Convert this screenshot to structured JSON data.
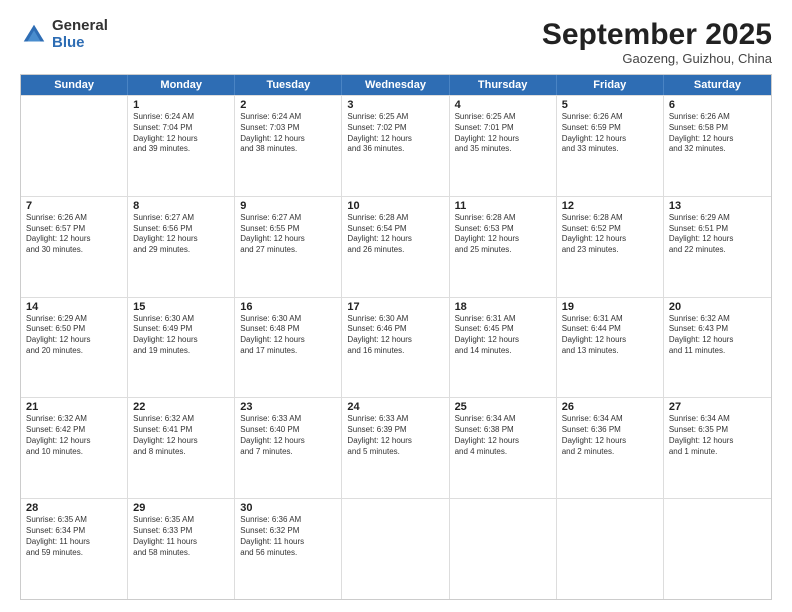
{
  "header": {
    "logo": {
      "general": "General",
      "blue": "Blue"
    },
    "title": "September 2025",
    "location": "Gaozeng, Guizhou, China"
  },
  "calendar": {
    "days": [
      "Sunday",
      "Monday",
      "Tuesday",
      "Wednesday",
      "Thursday",
      "Friday",
      "Saturday"
    ],
    "rows": [
      [
        {
          "day": "",
          "content": ""
        },
        {
          "day": "1",
          "content": "Sunrise: 6:24 AM\nSunset: 7:04 PM\nDaylight: 12 hours\nand 39 minutes."
        },
        {
          "day": "2",
          "content": "Sunrise: 6:24 AM\nSunset: 7:03 PM\nDaylight: 12 hours\nand 38 minutes."
        },
        {
          "day": "3",
          "content": "Sunrise: 6:25 AM\nSunset: 7:02 PM\nDaylight: 12 hours\nand 36 minutes."
        },
        {
          "day": "4",
          "content": "Sunrise: 6:25 AM\nSunset: 7:01 PM\nDaylight: 12 hours\nand 35 minutes."
        },
        {
          "day": "5",
          "content": "Sunrise: 6:26 AM\nSunset: 6:59 PM\nDaylight: 12 hours\nand 33 minutes."
        },
        {
          "day": "6",
          "content": "Sunrise: 6:26 AM\nSunset: 6:58 PM\nDaylight: 12 hours\nand 32 minutes."
        }
      ],
      [
        {
          "day": "7",
          "content": "Sunrise: 6:26 AM\nSunset: 6:57 PM\nDaylight: 12 hours\nand 30 minutes."
        },
        {
          "day": "8",
          "content": "Sunrise: 6:27 AM\nSunset: 6:56 PM\nDaylight: 12 hours\nand 29 minutes."
        },
        {
          "day": "9",
          "content": "Sunrise: 6:27 AM\nSunset: 6:55 PM\nDaylight: 12 hours\nand 27 minutes."
        },
        {
          "day": "10",
          "content": "Sunrise: 6:28 AM\nSunset: 6:54 PM\nDaylight: 12 hours\nand 26 minutes."
        },
        {
          "day": "11",
          "content": "Sunrise: 6:28 AM\nSunset: 6:53 PM\nDaylight: 12 hours\nand 25 minutes."
        },
        {
          "day": "12",
          "content": "Sunrise: 6:28 AM\nSunset: 6:52 PM\nDaylight: 12 hours\nand 23 minutes."
        },
        {
          "day": "13",
          "content": "Sunrise: 6:29 AM\nSunset: 6:51 PM\nDaylight: 12 hours\nand 22 minutes."
        }
      ],
      [
        {
          "day": "14",
          "content": "Sunrise: 6:29 AM\nSunset: 6:50 PM\nDaylight: 12 hours\nand 20 minutes."
        },
        {
          "day": "15",
          "content": "Sunrise: 6:30 AM\nSunset: 6:49 PM\nDaylight: 12 hours\nand 19 minutes."
        },
        {
          "day": "16",
          "content": "Sunrise: 6:30 AM\nSunset: 6:48 PM\nDaylight: 12 hours\nand 17 minutes."
        },
        {
          "day": "17",
          "content": "Sunrise: 6:30 AM\nSunset: 6:46 PM\nDaylight: 12 hours\nand 16 minutes."
        },
        {
          "day": "18",
          "content": "Sunrise: 6:31 AM\nSunset: 6:45 PM\nDaylight: 12 hours\nand 14 minutes."
        },
        {
          "day": "19",
          "content": "Sunrise: 6:31 AM\nSunset: 6:44 PM\nDaylight: 12 hours\nand 13 minutes."
        },
        {
          "day": "20",
          "content": "Sunrise: 6:32 AM\nSunset: 6:43 PM\nDaylight: 12 hours\nand 11 minutes."
        }
      ],
      [
        {
          "day": "21",
          "content": "Sunrise: 6:32 AM\nSunset: 6:42 PM\nDaylight: 12 hours\nand 10 minutes."
        },
        {
          "day": "22",
          "content": "Sunrise: 6:32 AM\nSunset: 6:41 PM\nDaylight: 12 hours\nand 8 minutes."
        },
        {
          "day": "23",
          "content": "Sunrise: 6:33 AM\nSunset: 6:40 PM\nDaylight: 12 hours\nand 7 minutes."
        },
        {
          "day": "24",
          "content": "Sunrise: 6:33 AM\nSunset: 6:39 PM\nDaylight: 12 hours\nand 5 minutes."
        },
        {
          "day": "25",
          "content": "Sunrise: 6:34 AM\nSunset: 6:38 PM\nDaylight: 12 hours\nand 4 minutes."
        },
        {
          "day": "26",
          "content": "Sunrise: 6:34 AM\nSunset: 6:36 PM\nDaylight: 12 hours\nand 2 minutes."
        },
        {
          "day": "27",
          "content": "Sunrise: 6:34 AM\nSunset: 6:35 PM\nDaylight: 12 hours\nand 1 minute."
        }
      ],
      [
        {
          "day": "28",
          "content": "Sunrise: 6:35 AM\nSunset: 6:34 PM\nDaylight: 11 hours\nand 59 minutes."
        },
        {
          "day": "29",
          "content": "Sunrise: 6:35 AM\nSunset: 6:33 PM\nDaylight: 11 hours\nand 58 minutes."
        },
        {
          "day": "30",
          "content": "Sunrise: 6:36 AM\nSunset: 6:32 PM\nDaylight: 11 hours\nand 56 minutes."
        },
        {
          "day": "",
          "content": ""
        },
        {
          "day": "",
          "content": ""
        },
        {
          "day": "",
          "content": ""
        },
        {
          "day": "",
          "content": ""
        }
      ]
    ]
  }
}
